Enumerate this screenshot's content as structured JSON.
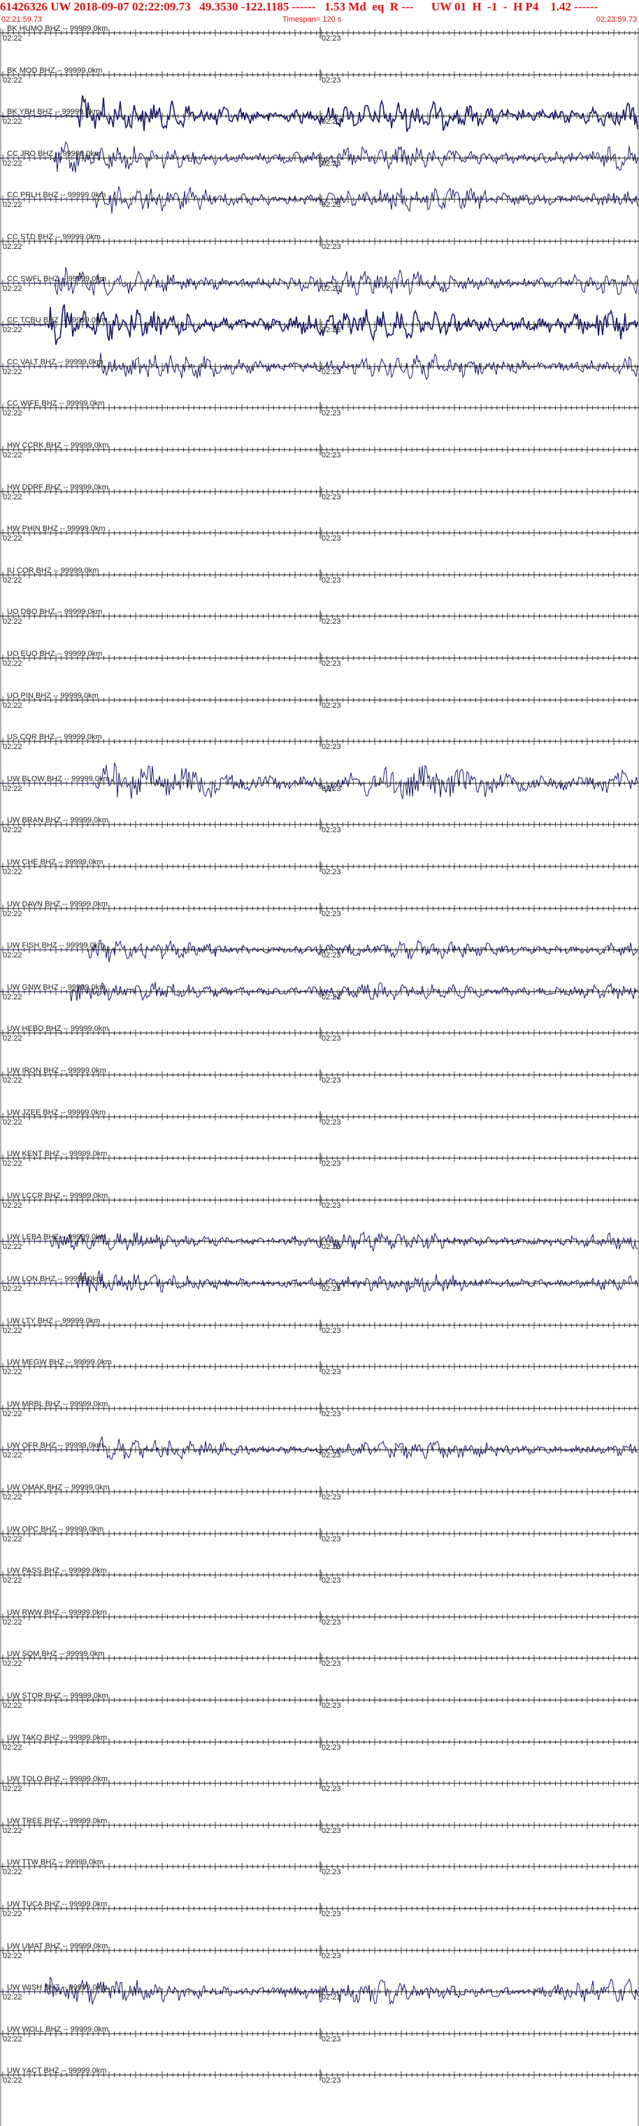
{
  "header": {
    "title": "61426326 UW 2018-09-07 02:22:09.73   49.3530 -122.1185 ------   1.53 Md  eq  R ---      UW 01  H  -1  -  H P4    1.42 ------",
    "start_time": "02:21:59.73",
    "timespan": "Timespan= 120 s",
    "end_time": "02:23:59.73"
  },
  "tick_labels": {
    "left": "02:22",
    "mid": "02:23"
  },
  "colors": {
    "header_text": "#e01010",
    "trace": "#1a1a66",
    "axis": "#111111"
  },
  "traces": [
    {
      "label": "BK HUMO BHZ -- 99999.0km",
      "signal": "none"
    },
    {
      "label": "BK MOD BHZ -- 99999.0km",
      "signal": "none"
    },
    {
      "label": "BK YBH BHZ -- 99999.0km",
      "signal": "heavy"
    },
    {
      "label": "CC JRO BHZ -- 99999.0km",
      "signal": "medium"
    },
    {
      "label": "CC PRLH BHZ -- 99999.0km",
      "signal": "medium"
    },
    {
      "label": "CC STD BHZ -- 99999.0km",
      "signal": "none"
    },
    {
      "label": "CC SWFL BHZ -- 99999.0km",
      "signal": "medium"
    },
    {
      "label": "CC TCBU BHZ -- 99999.0km",
      "signal": "heavy"
    },
    {
      "label": "CC VALT BHZ -- 99999.0km",
      "signal": "medium"
    },
    {
      "label": "CC WIFE BHZ -- 99999.0km",
      "signal": "none"
    },
    {
      "label": "HW CCRK BHZ -- 99999.0km",
      "signal": "none"
    },
    {
      "label": "HW DDRF BHZ -- 99999.0km",
      "signal": "none"
    },
    {
      "label": "HW PHIN BHZ -- 99999.0km",
      "signal": "none"
    },
    {
      "label": "IU COR BHZ -- 99999.0km",
      "signal": "none"
    },
    {
      "label": "UO DBO BHZ -- 99999.0km",
      "signal": "none"
    },
    {
      "label": "UO EUO BHZ -- 99999.0km",
      "signal": "none"
    },
    {
      "label": "UO PIN BHZ -- 99999.0km",
      "signal": "none"
    },
    {
      "label": "US COR BHZ -- 99999.0km",
      "signal": "none"
    },
    {
      "label": "UW BLOW BHZ -- 99999.0km",
      "signal": "big"
    },
    {
      "label": "UW BRAN BHZ -- 99999.0km",
      "signal": "none"
    },
    {
      "label": "UW CHE BHZ -- 99999.0km",
      "signal": "none"
    },
    {
      "label": "UW DAVN BHZ -- 99999.0km",
      "signal": "none"
    },
    {
      "label": "UW FISH BHZ -- 99999.0km",
      "signal": "small"
    },
    {
      "label": "UW GNW BHZ -- 99999.0km",
      "signal": "small"
    },
    {
      "label": "UW HEBO BHZ -- 99999.0km",
      "signal": "none"
    },
    {
      "label": "UW IRON BHZ -- 99999.0km",
      "signal": "none"
    },
    {
      "label": "UW JZEE BHZ -- 99999.0km",
      "signal": "none"
    },
    {
      "label": "UW KENT BHZ -- 99999.0km",
      "signal": "none"
    },
    {
      "label": "UW LCCR BHZ -- 99999.0km",
      "signal": "none"
    },
    {
      "label": "UW LEBA BHZ -- 99999.0km",
      "signal": "small"
    },
    {
      "label": "UW LON BHZ -- 99999.0km",
      "signal": "small"
    },
    {
      "label": "UW LTY BHZ -- 99999.0km",
      "signal": "none"
    },
    {
      "label": "UW MEGW BHZ -- 99999.0km",
      "signal": "none"
    },
    {
      "label": "UW MRBL BHZ -- 99999.0km",
      "signal": "none"
    },
    {
      "label": "UW OFR BHZ -- 99999.0km",
      "signal": "small"
    },
    {
      "label": "UW OMAK BHZ -- 99999.0km",
      "signal": "none"
    },
    {
      "label": "UW OPC BHZ -- 99999.0km",
      "signal": "none"
    },
    {
      "label": "UW PASS BHZ -- 99999.0km",
      "signal": "none"
    },
    {
      "label": "UW RWW BHZ -- 99999.0km",
      "signal": "none"
    },
    {
      "label": "UW SQM BHZ -- 99999.0km",
      "signal": "none"
    },
    {
      "label": "UW STOR BHZ -- 99999.0km",
      "signal": "none"
    },
    {
      "label": "UW TAKO BHZ -- 99999.0km",
      "signal": "none"
    },
    {
      "label": "UW TOLO BHZ -- 99999.0km",
      "signal": "none"
    },
    {
      "label": "UW TREE BHZ -- 99999.0km",
      "signal": "none"
    },
    {
      "label": "UW TTW BHZ -- 99999.0km",
      "signal": "none"
    },
    {
      "label": "UW TUCA BHZ -- 99999.0km",
      "signal": "none"
    },
    {
      "label": "UW UMAT BHZ -- 99999.0km",
      "signal": "none"
    },
    {
      "label": "UW WISH BHZ -- 99999.0km",
      "signal": "medium"
    },
    {
      "label": "UW WOLL BHZ -- 99999.0km",
      "signal": "none"
    },
    {
      "label": "UW YACT BHZ -- 99999.0km",
      "signal": "none"
    }
  ]
}
